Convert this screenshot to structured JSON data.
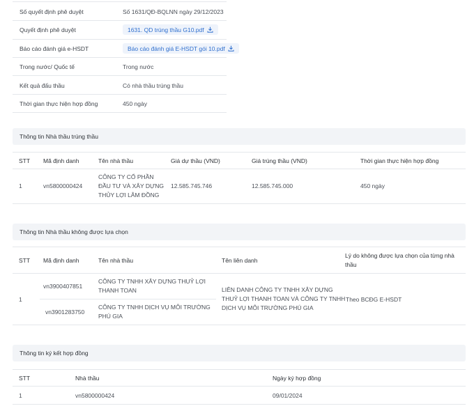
{
  "info": {
    "rows": [
      {
        "label": "Số quyết định phê duyệt",
        "value": "Số 1631/QĐ-BQLNN ngày 29/12/2023"
      },
      {
        "label": "Quyết định phê duyệt",
        "file": "1631. QD trúng thầu G10.pdf"
      },
      {
        "label": "Báo cáo đánh giá e-HSDT",
        "file": "Báo cáo đánh giá E-HSDT gói 10.pdf"
      },
      {
        "label": "Trong nước/ Quốc tế",
        "value": "Trong nước"
      },
      {
        "label": "Kết quả đấu thầu",
        "value": "Có nhà thầu trúng thầu"
      },
      {
        "label": "Thời gian thực hiện hợp đồng",
        "value": "450 ngày"
      }
    ],
    "download_icon": "download-icon"
  },
  "winner": {
    "title": "Thông tin Nhà thầu trúng thầu",
    "headers": [
      "STT",
      "Mã định danh",
      "Tên nhà thầu",
      "Giá dự thầu (VND)",
      "Giá trúng thầu (VND)",
      "Thời gian thực hiện hợp đồng"
    ],
    "row": {
      "stt": "1",
      "id": "vn5800000424",
      "name": [
        "CÔNG TY CỔ PHẦN",
        "ĐẦU TƯ VÀ XÂY DỰNG",
        "THỦY LỢI LÂM ĐỒNG"
      ],
      "bid_price": "12.585.745.746",
      "win_price": "12.585.745.000",
      "duration": "450 ngày"
    }
  },
  "rejected": {
    "title": "Thông tin Nhà thầu không được lựa chọn",
    "headers": [
      "STT",
      "Mã định danh",
      "Tên nhà thầu",
      "Tên liên danh",
      "Lý do không được lựa chọn của từng nhà",
      "thầu"
    ],
    "row": {
      "stt": "1",
      "members": [
        {
          "id": "vn3900407851",
          "name": [
            "CÔNG TY TNHH XÂY DỰNG THUỶ LỢI",
            "THANH TOAN"
          ]
        },
        {
          "id": "vn3901283750",
          "name": [
            "CÔNG TY TNHH DỊCH VỤ MÔI TRƯỜNG",
            "PHÚ GIA"
          ]
        }
      ],
      "consortium": [
        "LIÊN DANH CÔNG TY TNHH XÂY DỰNG",
        "THUỶ LỢI THANH TOAN VÀ CÔNG TY TNHH",
        "DỊCH VỤ MÔI TRƯỜNG PHÚ GIA"
      ],
      "reason": "Theo BCĐG E-HSDT"
    }
  },
  "contract": {
    "title": "Thông tin ký kết hợp đồng",
    "headers": [
      "STT",
      "Nhà thầu",
      "Ngày ký hợp đồng"
    ],
    "row": {
      "stt": "1",
      "contractor": "vn5800000424",
      "date": "09/01/2024"
    }
  }
}
